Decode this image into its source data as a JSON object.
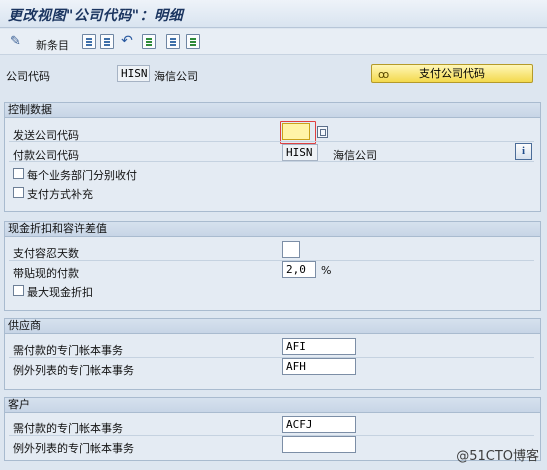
{
  "window": {
    "title": "更改视图\"公司代码\"：明细"
  },
  "toolbar": {
    "new_entries": "新条目"
  },
  "header": {
    "company_code_label": "公司代码",
    "company_code_value": "HISN",
    "company_name": "海信公司",
    "paying_cc_button": "支付公司代码"
  },
  "control": {
    "title": "控制数据",
    "sending_cc_label": "发送公司代码",
    "sending_cc_value": "",
    "paying_cc_label": "付款公司代码",
    "paying_cc_value": "HISN",
    "paying_cc_name": "海信公司",
    "info_label": "i",
    "sep_payment_label": "每个业务部门分别收付",
    "pm_supplement_label": "支付方式补充"
  },
  "discount": {
    "title": "现金折扣和容许差值",
    "grace_days_label": "支付容忍天数",
    "grace_days_value": "",
    "max_cd_label": "带贴现的付款",
    "max_cd_value": "2,0",
    "max_cd_unit": "%",
    "max_discount_label": "最大现金折扣"
  },
  "vendor": {
    "title": "供应商",
    "sgl_payable_label": "需付款的专门帐本事务",
    "sgl_payable_value": "AFI",
    "sgl_exception_label": "例外列表的专门帐本事务",
    "sgl_exception_value": "AFH"
  },
  "customer": {
    "title": "客户",
    "sgl_payable_label": "需付款的专门帐本事务",
    "sgl_payable_value": "ACFJ",
    "sgl_exception_label": "例外列表的专门帐本事务",
    "sgl_exception_value": ""
  },
  "watermark": "@51CTO博客"
}
